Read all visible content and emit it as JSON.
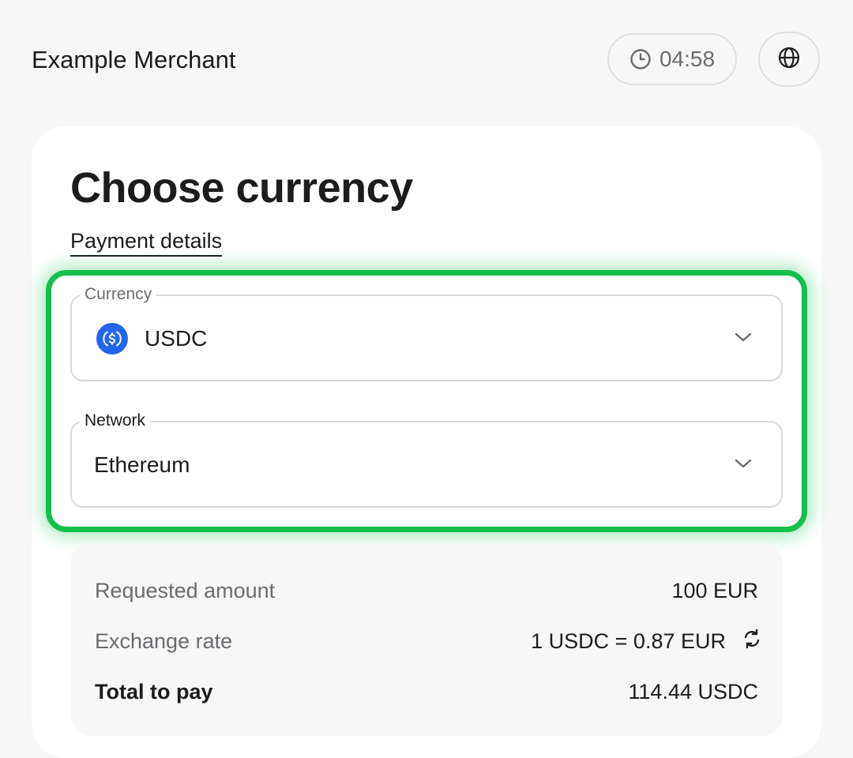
{
  "header": {
    "merchant_name": "Example Merchant",
    "timer": "04:58",
    "timer_icon": "clock-icon",
    "language_icon": "globe-icon"
  },
  "main": {
    "title": "Choose currency",
    "details_link": "Payment details"
  },
  "currency_select": {
    "label": "Currency",
    "value": "USDC",
    "icon": "usdc-coin-icon",
    "icon_color": "#2466f0"
  },
  "network_select": {
    "label": "Network",
    "value": "Ethereum"
  },
  "summary": {
    "requested_amount_label": "Requested amount",
    "requested_amount_value": "100 EUR",
    "exchange_rate_label": "Exchange rate",
    "exchange_rate_value": "1 USDC = 0.87 EUR",
    "total_label": "Total to pay",
    "total_value": "114.44 USDC"
  },
  "colors": {
    "highlight": "#14bf4f",
    "accent_blue": "#2466f0"
  }
}
